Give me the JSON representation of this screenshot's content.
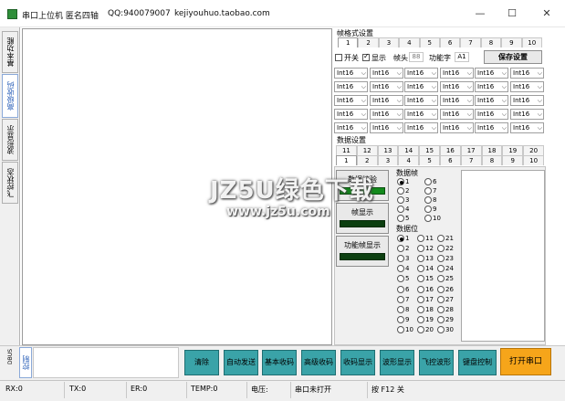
{
  "titlebar": {
    "app_title": "串口上位机 匿名四轴",
    "qq": "QQ:940079007",
    "shop": "kejiyouhuo.taobao.com",
    "minimize": "—",
    "maximize": "☐",
    "close": "✕"
  },
  "left_tabs": {
    "basic": "基本功能",
    "advanced": "高级收码",
    "waveform": "波形显示",
    "flight_status": "飞控状态"
  },
  "frame_format": {
    "title": "帧格式设置",
    "tabs": [
      "1",
      "2",
      "3",
      "4",
      "5",
      "6",
      "7",
      "8",
      "9",
      "10"
    ],
    "switch_label": "开关",
    "display_label": "显示",
    "header_label": "帧头",
    "header_value": "88",
    "func_label": "功能字",
    "func_value": "A1",
    "save_label": "保存设置",
    "type_value": "Int16"
  },
  "data_settings": {
    "title": "数据设置",
    "tabs_row1": [
      "11",
      "12",
      "13",
      "14",
      "15",
      "16",
      "17",
      "18",
      "19",
      "20"
    ],
    "tabs_row2": [
      "1",
      "2",
      "3",
      "4",
      "5",
      "6",
      "7",
      "8",
      "9",
      "10"
    ],
    "checksum_label": "数据校验",
    "frame_display_label": "帧显示",
    "func_frame_display_label": "功能帧显示",
    "channel_title": "数据帧",
    "channels": [
      "1",
      "2",
      "3",
      "4",
      "5",
      "6",
      "7",
      "8",
      "9",
      "10"
    ],
    "bit_title": "数据位",
    "bits": [
      "1",
      "2",
      "3",
      "4",
      "5",
      "6",
      "7",
      "8",
      "9",
      "10",
      "11",
      "12",
      "13",
      "14",
      "15",
      "16",
      "17",
      "18",
      "19",
      "20",
      "21",
      "22",
      "23",
      "24",
      "25",
      "26",
      "27",
      "28",
      "29",
      "30"
    ]
  },
  "bottom": {
    "dbus_label": "DBUS",
    "control_tab": "控制",
    "clear": "清除",
    "auto_send": "自动发送",
    "basic_recv": "基本收码",
    "advanced_recv": "高级收码",
    "recv_display": "收码显示",
    "waveform_display": "波形显示",
    "fc_waveform": "飞控波形",
    "key_control": "键盘控制",
    "open_port": "打开串口"
  },
  "status": {
    "rx": "RX:0",
    "tx": "TX:0",
    "er": "ER:0",
    "temp": "TEMP:0",
    "voltage": "电压:",
    "port_state": "串口未打开",
    "hint": "按 F12 关"
  },
  "watermark": {
    "line1": "JZ5U绿色下载",
    "line2": "www.jz5u.com"
  },
  "colors": {
    "teal_button": "#3aa3a8",
    "open_port_button": "#f6a51a",
    "indicator_green": "#138a1c",
    "indicator_dark": "#0c3f10"
  }
}
